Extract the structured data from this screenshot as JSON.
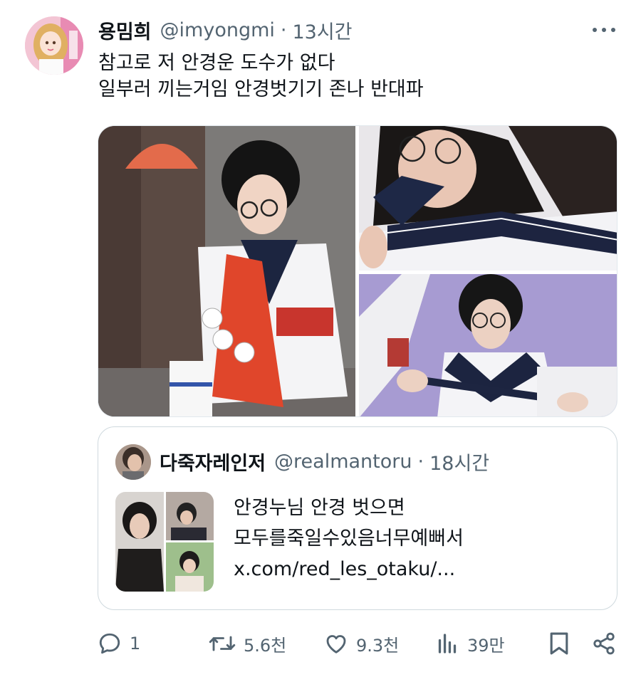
{
  "tweet": {
    "author": {
      "display_name": "용밈희",
      "handle": "@imyongmi",
      "time": "13시간",
      "avatar_icon": "doll-avatar"
    },
    "separator": "·",
    "more_icon": "more-icon",
    "text_lines": [
      "참고로 저 안경운 도수가 없다",
      "일부러 끼는거임 안경벗기기 존나 반대파"
    ],
    "photos": [
      {
        "icon": "photo-girl-sailor-uniform-traffic-cone"
      },
      {
        "icon": "photo-girl-glasses-biting-scarf"
      },
      {
        "icon": "photo-girl-glasses-purple-wall"
      }
    ]
  },
  "quote": {
    "author": {
      "display_name": "다죽자레인저",
      "handle": "@realmantoru",
      "time": "18시간",
      "avatar_icon": "quote-author-avatar"
    },
    "separator": "·",
    "text_lines": [
      "안경누님 안경 벗으면",
      "모두를죽일수있음너무예뻐서",
      "x.com/red_les_otaku/..."
    ],
    "thumbnail_icon": "quote-photo-collage"
  },
  "actions": {
    "reply": {
      "icon": "reply-icon",
      "count": "1"
    },
    "repost": {
      "icon": "repost-icon",
      "count": "5.6천"
    },
    "like": {
      "icon": "heart-icon",
      "count": "9.3천"
    },
    "views": {
      "icon": "views-icon",
      "count": "39만"
    },
    "bookmark": {
      "icon": "bookmark-icon"
    },
    "share": {
      "icon": "share-icon"
    }
  },
  "colors": {
    "text_primary": "#0f1419",
    "text_secondary": "#536471",
    "border": "#cfd9de"
  }
}
